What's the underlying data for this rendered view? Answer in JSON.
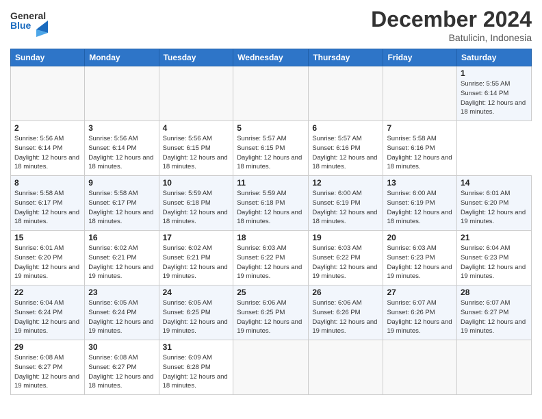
{
  "header": {
    "logo_line1": "General",
    "logo_line2": "Blue",
    "title": "December 2024",
    "subtitle": "Batulicin, Indonesia"
  },
  "calendar": {
    "weekdays": [
      "Sunday",
      "Monday",
      "Tuesday",
      "Wednesday",
      "Thursday",
      "Friday",
      "Saturday"
    ],
    "weeks": [
      [
        null,
        null,
        null,
        null,
        null,
        null,
        {
          "day": 1,
          "sunrise": "5:55 AM",
          "sunset": "6:14 PM",
          "daylight": "12 hours and 18 minutes."
        }
      ],
      [
        {
          "day": 2,
          "sunrise": "5:56 AM",
          "sunset": "6:14 PM",
          "daylight": "12 hours and 18 minutes."
        },
        {
          "day": 3,
          "sunrise": "5:56 AM",
          "sunset": "6:14 PM",
          "daylight": "12 hours and 18 minutes."
        },
        {
          "day": 4,
          "sunrise": "5:56 AM",
          "sunset": "6:15 PM",
          "daylight": "12 hours and 18 minutes."
        },
        {
          "day": 5,
          "sunrise": "5:57 AM",
          "sunset": "6:15 PM",
          "daylight": "12 hours and 18 minutes."
        },
        {
          "day": 6,
          "sunrise": "5:57 AM",
          "sunset": "6:16 PM",
          "daylight": "12 hours and 18 minutes."
        },
        {
          "day": 7,
          "sunrise": "5:58 AM",
          "sunset": "6:16 PM",
          "daylight": "12 hours and 18 minutes."
        }
      ],
      [
        {
          "day": 8,
          "sunrise": "5:58 AM",
          "sunset": "6:17 PM",
          "daylight": "12 hours and 18 minutes."
        },
        {
          "day": 9,
          "sunrise": "5:58 AM",
          "sunset": "6:17 PM",
          "daylight": "12 hours and 18 minutes."
        },
        {
          "day": 10,
          "sunrise": "5:59 AM",
          "sunset": "6:18 PM",
          "daylight": "12 hours and 18 minutes."
        },
        {
          "day": 11,
          "sunrise": "5:59 AM",
          "sunset": "6:18 PM",
          "daylight": "12 hours and 18 minutes."
        },
        {
          "day": 12,
          "sunrise": "6:00 AM",
          "sunset": "6:19 PM",
          "daylight": "12 hours and 18 minutes."
        },
        {
          "day": 13,
          "sunrise": "6:00 AM",
          "sunset": "6:19 PM",
          "daylight": "12 hours and 18 minutes."
        },
        {
          "day": 14,
          "sunrise": "6:01 AM",
          "sunset": "6:20 PM",
          "daylight": "12 hours and 19 minutes."
        }
      ],
      [
        {
          "day": 15,
          "sunrise": "6:01 AM",
          "sunset": "6:20 PM",
          "daylight": "12 hours and 19 minutes."
        },
        {
          "day": 16,
          "sunrise": "6:02 AM",
          "sunset": "6:21 PM",
          "daylight": "12 hours and 19 minutes."
        },
        {
          "day": 17,
          "sunrise": "6:02 AM",
          "sunset": "6:21 PM",
          "daylight": "12 hours and 19 minutes."
        },
        {
          "day": 18,
          "sunrise": "6:03 AM",
          "sunset": "6:22 PM",
          "daylight": "12 hours and 19 minutes."
        },
        {
          "day": 19,
          "sunrise": "6:03 AM",
          "sunset": "6:22 PM",
          "daylight": "12 hours and 19 minutes."
        },
        {
          "day": 20,
          "sunrise": "6:03 AM",
          "sunset": "6:23 PM",
          "daylight": "12 hours and 19 minutes."
        },
        {
          "day": 21,
          "sunrise": "6:04 AM",
          "sunset": "6:23 PM",
          "daylight": "12 hours and 19 minutes."
        }
      ],
      [
        {
          "day": 22,
          "sunrise": "6:04 AM",
          "sunset": "6:24 PM",
          "daylight": "12 hours and 19 minutes."
        },
        {
          "day": 23,
          "sunrise": "6:05 AM",
          "sunset": "6:24 PM",
          "daylight": "12 hours and 19 minutes."
        },
        {
          "day": 24,
          "sunrise": "6:05 AM",
          "sunset": "6:25 PM",
          "daylight": "12 hours and 19 minutes."
        },
        {
          "day": 25,
          "sunrise": "6:06 AM",
          "sunset": "6:25 PM",
          "daylight": "12 hours and 19 minutes."
        },
        {
          "day": 26,
          "sunrise": "6:06 AM",
          "sunset": "6:26 PM",
          "daylight": "12 hours and 19 minutes."
        },
        {
          "day": 27,
          "sunrise": "6:07 AM",
          "sunset": "6:26 PM",
          "daylight": "12 hours and 19 minutes."
        },
        {
          "day": 28,
          "sunrise": "6:07 AM",
          "sunset": "6:27 PM",
          "daylight": "12 hours and 19 minutes."
        }
      ],
      [
        {
          "day": 29,
          "sunrise": "6:08 AM",
          "sunset": "6:27 PM",
          "daylight": "12 hours and 19 minutes."
        },
        {
          "day": 30,
          "sunrise": "6:08 AM",
          "sunset": "6:27 PM",
          "daylight": "12 hours and 18 minutes."
        },
        {
          "day": 31,
          "sunrise": "6:09 AM",
          "sunset": "6:28 PM",
          "daylight": "12 hours and 18 minutes."
        },
        null,
        null,
        null,
        null
      ]
    ]
  }
}
